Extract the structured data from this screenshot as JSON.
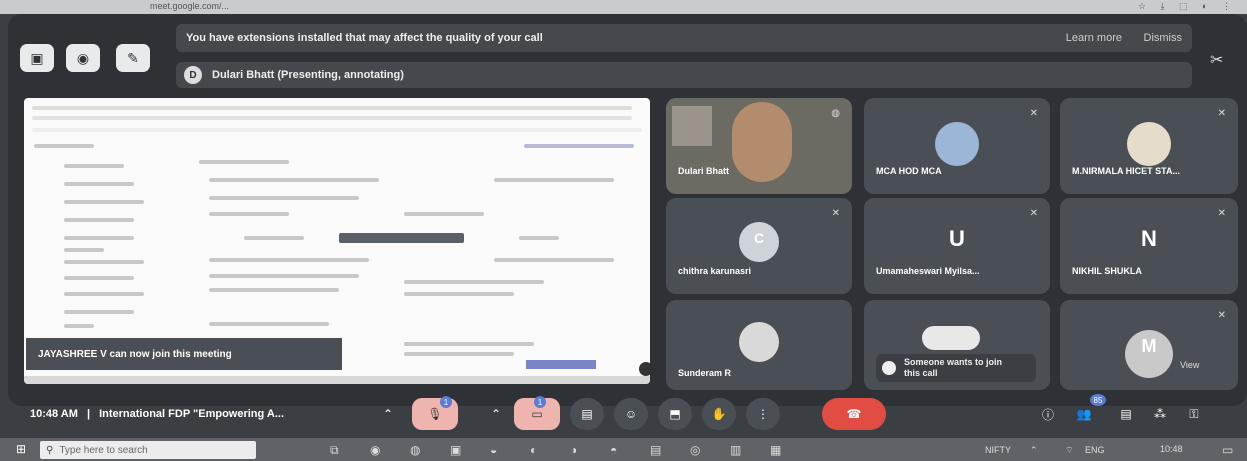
{
  "browser": {
    "url": "meet.google.com/...",
    "right_icons": "☆ ⤓ ⬚ ◐ ⋮"
  },
  "banner": {
    "message": "You have extensions installed that may affect the quality of your call",
    "learn_more": "Learn more",
    "dismiss": "Dismiss"
  },
  "presenter": {
    "initial": "D",
    "label": "Dulari Bhatt (Presenting, annotating)"
  },
  "toast": {
    "text": "JAYASHREE V can now join this meeting"
  },
  "tiles": [
    {
      "name": "Dulari Bhatt"
    },
    {
      "name": "MCA HOD MCA"
    },
    {
      "name": "M.NIRMALA HICET STA..."
    },
    {
      "name": "chithra karunasri",
      "letter": "C"
    },
    {
      "name": "Umamaheswari Myilsa...",
      "letter": "U"
    },
    {
      "name": "NIKHIL SHUKLA",
      "letter": "N"
    },
    {
      "name": "Sunderam R"
    },
    {
      "name": "",
      "letter": "M"
    }
  ],
  "join_request": {
    "text": "Someone wants to join this call",
    "action": "View"
  },
  "meeting": {
    "time": "10:48 AM",
    "separator": "|",
    "title": "International FDP \"Empowering A..."
  },
  "counts": {
    "participants": "85",
    "hand": "1",
    "cam": "1"
  },
  "taskbar": {
    "search_placeholder": "Type here to search",
    "nifty": "NIFTY",
    "lang": "ENG",
    "clock": "10:48"
  },
  "colors": {
    "end_call": "#e24d43",
    "muted_red": "#f0b4ae"
  }
}
